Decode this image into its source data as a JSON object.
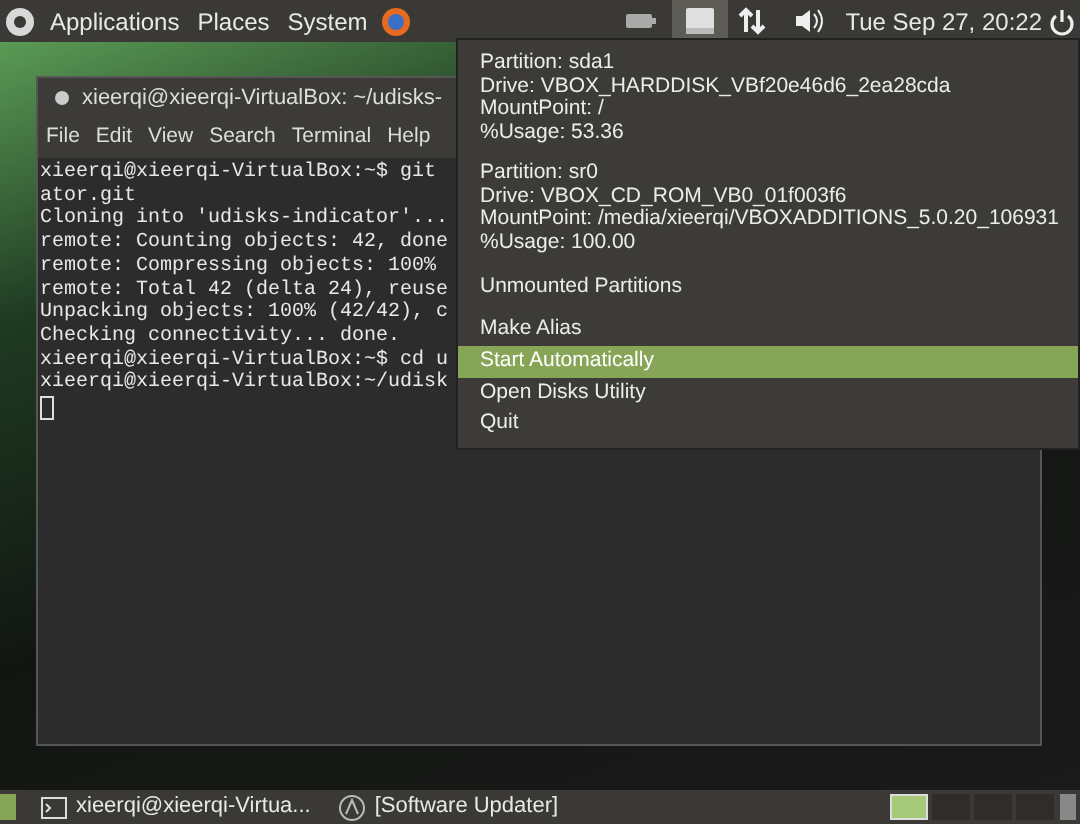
{
  "top_panel": {
    "menus": [
      "Applications",
      "Places",
      "System"
    ],
    "clock": "Tue Sep 27, 20:22",
    "indicators": [
      {
        "kind": "battery",
        "selected": false
      },
      {
        "kind": "drive",
        "selected": true
      },
      {
        "kind": "network",
        "selected": false
      },
      {
        "kind": "volume",
        "selected": false
      }
    ]
  },
  "terminal": {
    "title": "xieerqi@xieerqi-VirtualBox: ~/udisks-",
    "menu": [
      "File",
      "Edit",
      "View",
      "Search",
      "Terminal",
      "Help"
    ],
    "lines": [
      "xieerqi@xieerqi-VirtualBox:~$ git",
      "ator.git",
      "Cloning into 'udisks-indicator'...",
      "remote: Counting objects: 42, done",
      "remote: Compressing objects: 100%",
      "remote: Total 42 (delta 24), reuse",
      "Unpacking objects: 100% (42/42), c",
      "Checking connectivity... done.",
      "xieerqi@xieerqi-VirtualBox:~$ cd u",
      "xieerqi@xieerqi-VirtualBox:~/udisk"
    ]
  },
  "menu": {
    "partitions": [
      [
        "Partition: sda1",
        "Drive: VBOX_HARDDISK_VBf20e46d6_2ea28cda",
        "MountPoint: /",
        "%Usage: 53.36"
      ],
      [
        "Partition: sr0",
        "Drive: VBOX_CD_ROM_VB0_01f003f6",
        "MountPoint: /media/xieerqi/VBOXADDITIONS_5.0.20_106931",
        "%Usage: 100.00"
      ]
    ],
    "items": [
      {
        "label": "Unmounted Partitions",
        "selected": false
      },
      {
        "label": "Make Alias",
        "selected": false
      },
      {
        "label": "Start Automatically",
        "selected": true
      },
      {
        "label": "Open Disks Utility",
        "selected": false
      },
      {
        "label": "Quit",
        "selected": false
      }
    ]
  },
  "taskbar": {
    "items": [
      {
        "label": "xieerqi@xieerqi-Virtua...",
        "kind": "terminal"
      },
      {
        "label": "[Software Updater]",
        "kind": "updater"
      }
    ],
    "workspaces": [
      {
        "selected": true
      },
      {
        "selected": false
      },
      {
        "selected": false
      },
      {
        "selected": false
      }
    ]
  }
}
